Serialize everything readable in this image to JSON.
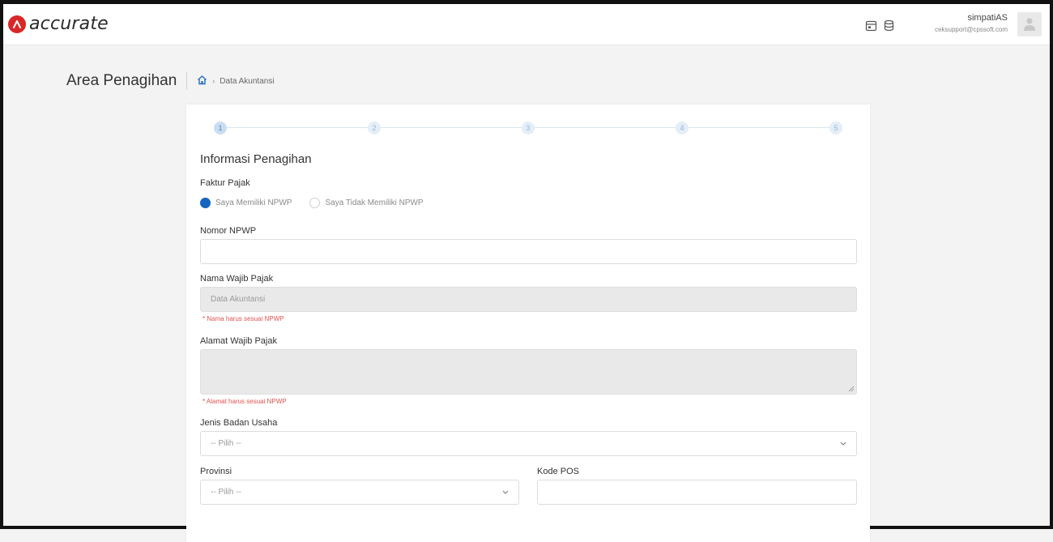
{
  "app": {
    "logo_text": "accurate",
    "brand_color": "#d92727"
  },
  "topbar": {
    "icons": [
      "calendar-icon",
      "database-icon"
    ],
    "user_name": "simpatiAS",
    "user_email": "ceksupport@cpssoft.com"
  },
  "page": {
    "title": "Area Penagihan",
    "breadcrumb": [
      "home-icon",
      "Data Akuntansi"
    ]
  },
  "stepper": {
    "steps": [
      "1",
      "2",
      "3",
      "4",
      "5"
    ],
    "active_index": 0
  },
  "form": {
    "section_title": "Informasi Penagihan",
    "faktur_pajak": {
      "label": "Faktur Pajak",
      "options": [
        "Saya Memiliki NPWP",
        "Saya Tidak Memiliki NPWP"
      ],
      "selected": "Saya Memiliki NPWP"
    },
    "nomor_npwp": {
      "label": "Nomor NPWP",
      "value": ""
    },
    "nama_wajib_pajak": {
      "label": "Nama Wajib Pajak",
      "value": "Data Akuntansi",
      "hint": "* Nama harus sesuai NPWP"
    },
    "alamat_wajib_pajak": {
      "label": "Alamat Wajib Pajak",
      "value": "",
      "hint": "* Alamat harus sesuai NPWP"
    },
    "jenis_badan_usaha": {
      "label": "Jenis Badan Usaha",
      "value": "-- Pilih --"
    },
    "provinsi": {
      "label": "Provinsi",
      "value": "-- Pilih --"
    },
    "kode_pos": {
      "label": "Kode POS",
      "value": ""
    }
  }
}
